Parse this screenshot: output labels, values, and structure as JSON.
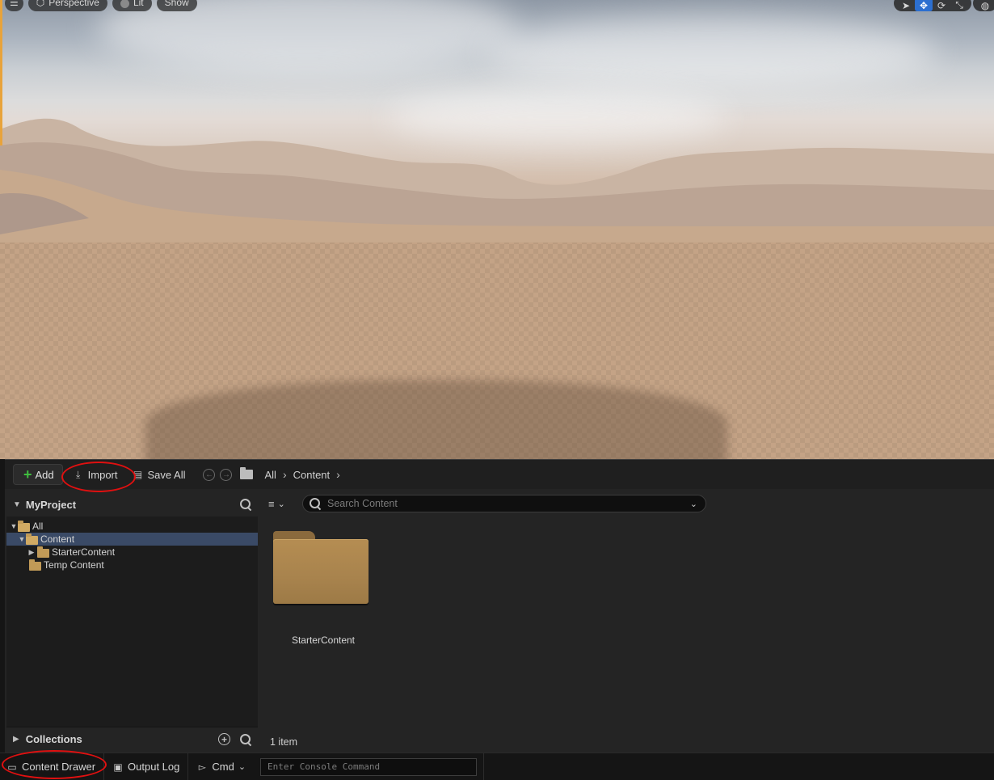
{
  "viewport": {
    "mode_label": "Perspective",
    "lighting_label": "Lit",
    "show_label": "Show"
  },
  "toolbar": {
    "add_label": "Add",
    "import_label": "Import",
    "save_all_label": "Save All",
    "breadcrumb": [
      "All",
      "Content"
    ]
  },
  "sources": {
    "project_name": "MyProject",
    "tree": [
      {
        "label": "All",
        "level": 0,
        "expanded": true,
        "selected": false
      },
      {
        "label": "Content",
        "level": 1,
        "expanded": true,
        "selected": true
      },
      {
        "label": "StarterContent",
        "level": 2,
        "expanded": false,
        "selected": false
      },
      {
        "label": "Temp Content",
        "level": 1,
        "expanded": false,
        "selected": false
      }
    ],
    "collections_label": "Collections"
  },
  "assets": {
    "search_placeholder": "Search Content",
    "items": [
      {
        "label": "StarterContent",
        "type": "folder"
      }
    ],
    "item_count": "1 item"
  },
  "status_bar": {
    "content_drawer_label": "Content Drawer",
    "output_log_label": "Output Log",
    "cmd_label": "Cmd",
    "console_placeholder": "Enter Console Command"
  },
  "colors": {
    "accent_selected": "#3a4a66",
    "add_plus": "#3fbf3f",
    "folder": "#b58d52",
    "annotation": "#e01010"
  }
}
